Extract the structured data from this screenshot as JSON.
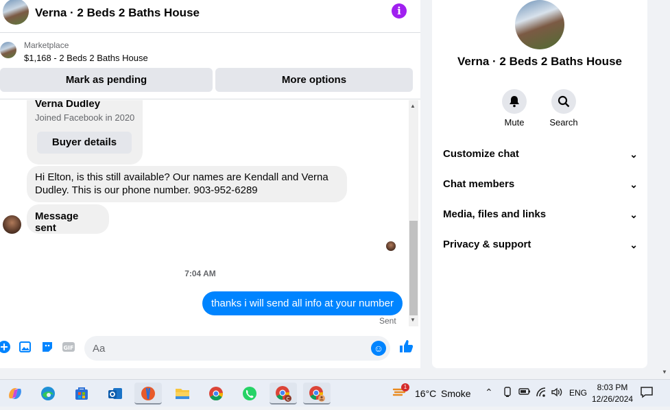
{
  "header": {
    "title": "Verna · 2 Beds 2 Baths House"
  },
  "marketplace": {
    "label": "Marketplace",
    "listing": "$1,168 - 2 Beds 2 Baths House"
  },
  "actions": {
    "pending": "Mark as pending",
    "more": "More options"
  },
  "profile_card": {
    "name": "Verna Dudley",
    "joined": "Joined Facebook in 2020",
    "button": "Buyer details"
  },
  "messages": {
    "incoming_1": "Hi Elton, is this still available? Our names are Kendall and Verna Dudley. This is our phone number. 903-952-6289",
    "incoming_2": "Message sent",
    "time_separator": "7:04 AM",
    "outgoing_1": "thanks i will send all info at your number",
    "status": "Sent"
  },
  "composer": {
    "placeholder": "Aa"
  },
  "sidebar": {
    "title": "Verna · 2 Beds 2 Baths House",
    "actions": [
      {
        "label": "Mute",
        "icon": "bell-icon"
      },
      {
        "label": "Search",
        "icon": "search-icon"
      }
    ],
    "sections": [
      "Customize chat",
      "Chat members",
      "Media, files and links",
      "Privacy & support"
    ]
  },
  "taskbar": {
    "weather": {
      "badge": "1",
      "temp": "16°C",
      "desc": "Smoke"
    },
    "language": "ENG",
    "time": "8:03 PM",
    "date": "12/26/2024"
  },
  "colors": {
    "accent": "#0084ff",
    "info": "#a020f0",
    "bubble_in": "#f0f0f0"
  }
}
